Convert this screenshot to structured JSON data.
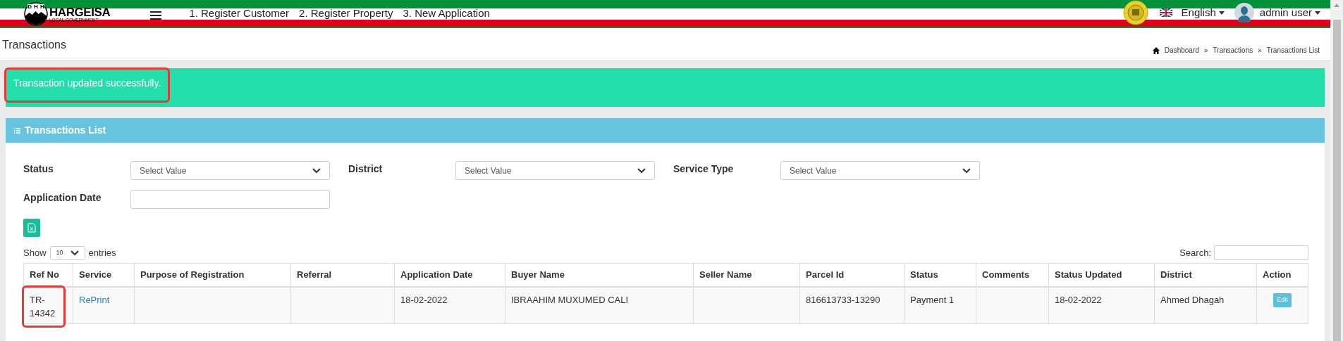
{
  "navbar": {
    "logo_title": "HARGEISA",
    "logo_subtitle": "LOCAL GOVERNMENT",
    "logo_letters": [
      "D",
      "H",
      "H"
    ],
    "links": [
      "1. Register Customer",
      "2. Register Property",
      "3. New Application"
    ],
    "language": "English",
    "user": "admin user"
  },
  "page_header": {
    "title": "Transactions",
    "breadcrumb": [
      "Dashboard",
      "Transactions",
      "Transactions List"
    ],
    "separator": "»"
  },
  "alert": {
    "message": "Transaction updated successfully.",
    "highlighted": true
  },
  "panel": {
    "title": "Transactions List",
    "filters": [
      {
        "label": "Status",
        "kind": "select",
        "value": "Select Value"
      },
      {
        "label": "District",
        "kind": "select",
        "value": "Select Value"
      },
      {
        "label": "Service Type",
        "kind": "select",
        "value": "Select Value"
      },
      {
        "label": "Application Date",
        "kind": "input"
      }
    ],
    "show_label": "Show",
    "page_size": "10",
    "entries_label": "entries",
    "search_label": "Search:",
    "table": {
      "columns": [
        "Ref No",
        "Service",
        "Purpose of Registration",
        "Referral",
        "Application Date",
        "Buyer Name",
        "Seller Name",
        "Parcel Id",
        "Status",
        "Comments",
        "Status Updated",
        "District",
        "Action"
      ],
      "rows": [
        {
          "ref_no": "TR-14342",
          "ref_highlighted": true,
          "service": "RePrint",
          "purpose": "",
          "referral": "",
          "application_date": "18-02-2022",
          "buyer_name": "IBRAAHIM MUXUMED CALI",
          "seller_name": "",
          "parcel_id": "816613733-13290",
          "status": "Payment 1",
          "comments": "",
          "status_updated": "18-02-2022",
          "district": "Ahmed Dhagah",
          "action": "Edit"
        }
      ]
    }
  }
}
